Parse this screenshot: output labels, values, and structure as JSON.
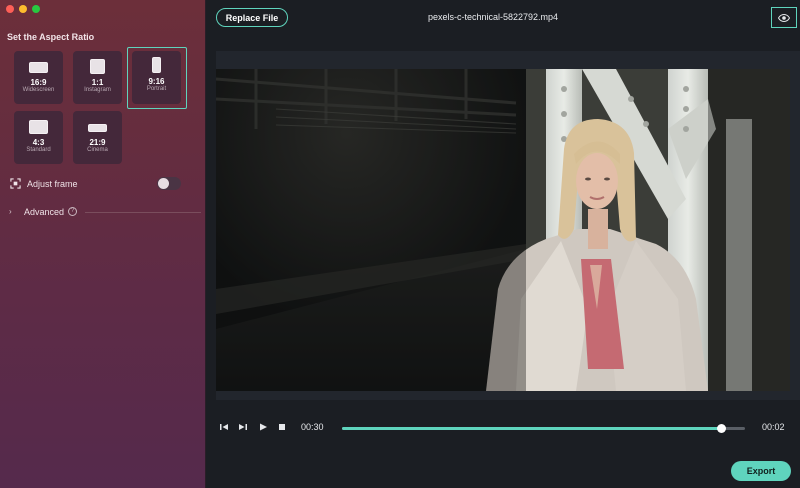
{
  "sidebar": {
    "section_title": "Set the Aspect Ratio",
    "ratios": [
      {
        "ratio": "16:9",
        "name": "Widescreen"
      },
      {
        "ratio": "1:1",
        "name": "Instagram"
      },
      {
        "ratio": "9:16",
        "name": "Portrait",
        "selected": true
      },
      {
        "ratio": "4:3",
        "name": "Standard"
      },
      {
        "ratio": "21:9",
        "name": "Cinema"
      }
    ],
    "adjust_frame_label": "Adjust frame",
    "adjust_frame_on": false,
    "advanced_label": "Advanced"
  },
  "toolbar": {
    "replace_label": "Replace File",
    "file_name": "pexels-c-technical-5822792.mp4"
  },
  "player": {
    "current_time": "00:30",
    "duration": "00:02",
    "progress": 0.94
  },
  "export_label": "Export",
  "colors": {
    "accent": "#5fd4bd",
    "sidebar_top": "#6c2f3a",
    "sidebar_bottom": "#552a4c",
    "main_bg": "#1b1e23"
  }
}
